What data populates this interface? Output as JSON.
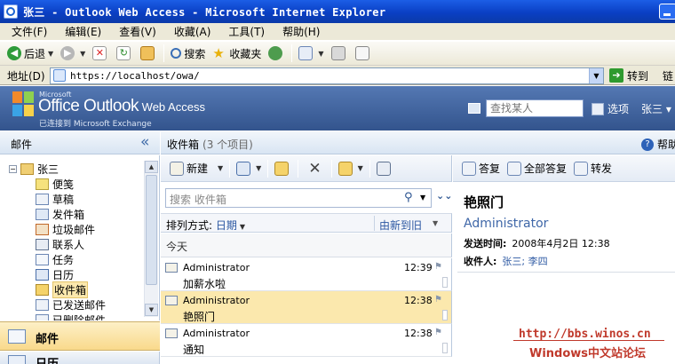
{
  "window": {
    "title": "张三 - Outlook Web Access - Microsoft Internet Explorer"
  },
  "menu": [
    "文件(F)",
    "编辑(E)",
    "查看(V)",
    "收藏(A)",
    "工具(T)",
    "帮助(H)"
  ],
  "ie_toolbar": {
    "back": "后退",
    "search": "搜索",
    "favorites": "收藏夹"
  },
  "address": {
    "label": "地址(D)",
    "url": "https://localhost/owa/",
    "go": "转到",
    "links": "链"
  },
  "owa": {
    "brand_ms": "Microsoft",
    "brand_office": "Office Outlook",
    "brand_wa": " Web Access",
    "brand_sub": "已连接到 Microsoft Exchange",
    "find_people_placeholder": "查找某人",
    "options": "选项",
    "user": "张三 ▾"
  },
  "nav": {
    "header": "邮件",
    "collapse": "«",
    "root": "张三",
    "folders": [
      "便笺",
      "草稿",
      "发件箱",
      "垃圾邮件",
      "联系人",
      "任务",
      "日历",
      "收件箱",
      "已发送邮件",
      "已删除邮件"
    ],
    "selected": "收件箱",
    "mail_button": "邮件",
    "calendar_button": "日历"
  },
  "list": {
    "title": "收件箱",
    "count": "(3 个项目)",
    "help": "帮助",
    "new_button": "新建",
    "search_placeholder": "搜索 收件箱",
    "sort_label": "排列方式:",
    "sort_value": "日期",
    "sort_order": "由新到旧",
    "group_today": "今天",
    "messages": [
      {
        "from": "Administrator",
        "subject": "加薪水啦",
        "time": "12:39",
        "selected": false
      },
      {
        "from": "Administrator",
        "subject": "艳照门",
        "time": "12:38",
        "selected": true
      },
      {
        "from": "Administrator",
        "subject": "通知",
        "time": "12:38",
        "selected": false
      }
    ]
  },
  "reading": {
    "reply": "答复",
    "reply_all": "全部答复",
    "forward": "转发",
    "subject": "艳照门",
    "from": "Administrator",
    "sent_label": "发送时间:",
    "sent_value": "2008年4月2日 12:38",
    "to_label": "收件人:",
    "to_value": "张三; 李四"
  },
  "watermark": {
    "line1": "http://bbs.winos.cn",
    "line2": "Windows中文站论坛"
  },
  "colors": {
    "owa_header": "#3e62a0",
    "selection": "#fbe8ad",
    "link": "#2b57a2",
    "watermark": "#c0392b"
  }
}
